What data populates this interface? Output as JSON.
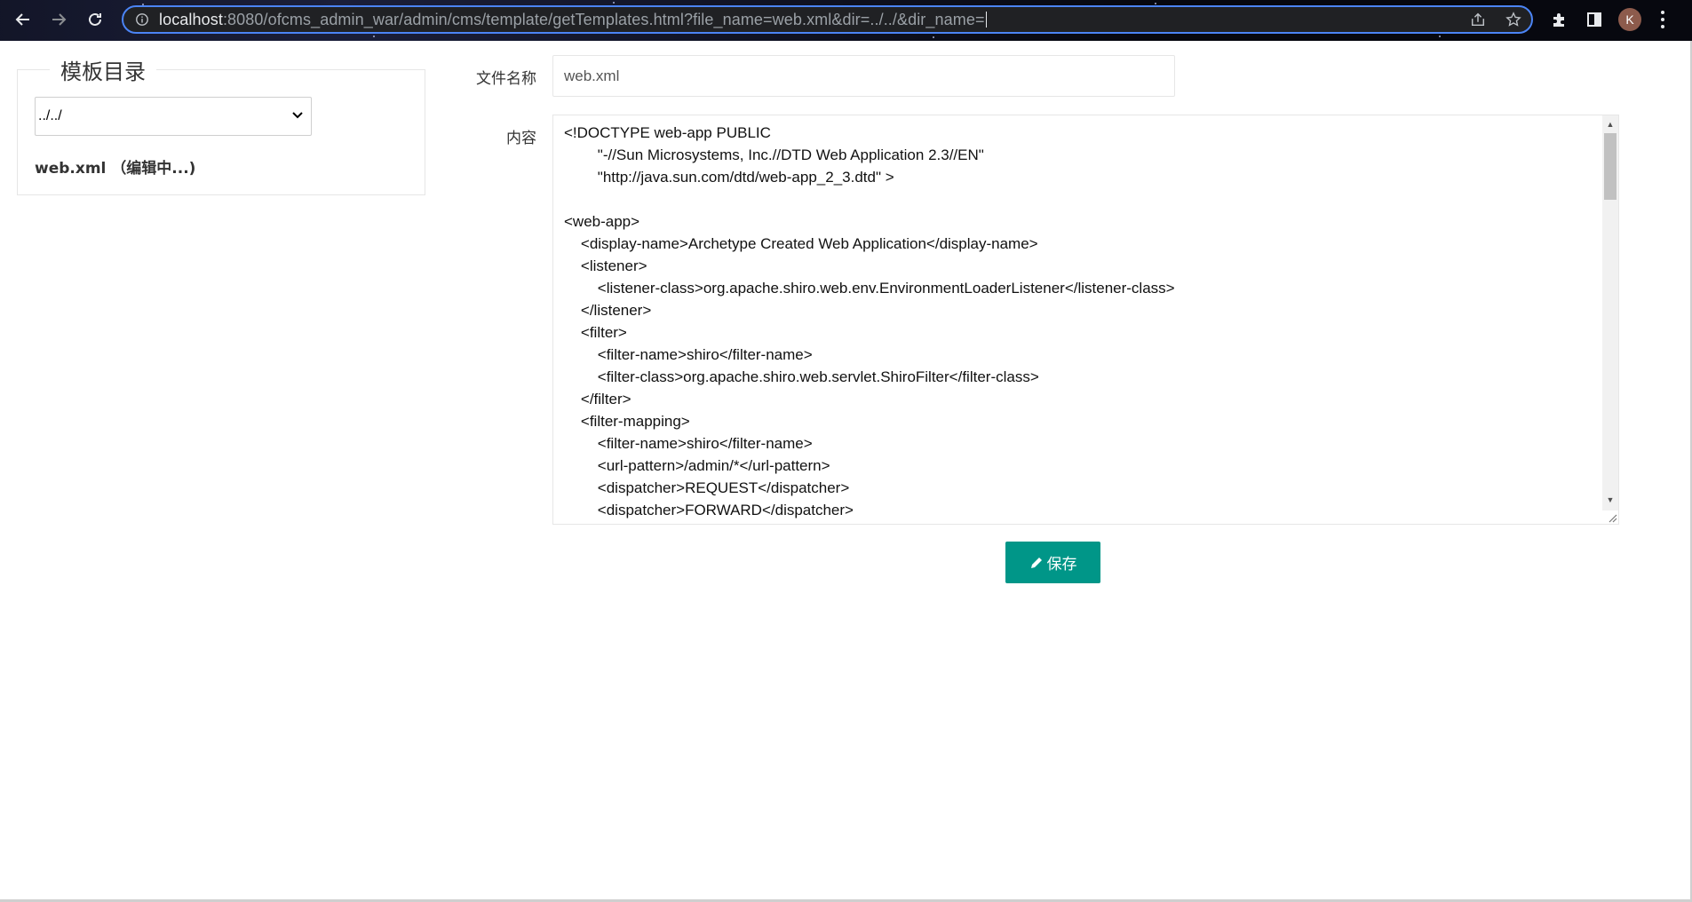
{
  "browser": {
    "url_host": "localhost",
    "url_rest": ":8080/ofcms_admin_war/admin/cms/template/getTemplates.html?file_name=web.xml&dir=../../&dir_name=",
    "profile_initial": "K",
    "accent_color": "#4b84f5"
  },
  "sidebar": {
    "title": "模板目录",
    "dir_selected": "../../",
    "file_label": "web.xml （编辑中...)"
  },
  "form": {
    "name_label": "文件名称",
    "name_value": "web.xml",
    "content_label": "内容",
    "content_lines": [
      "<!DOCTYPE web-app PUBLIC",
      "        \"-//Sun Microsystems, Inc.//DTD Web Application 2.3//EN\"",
      "        \"http://java.sun.com/dtd/web-app_2_3.dtd\" >",
      "",
      "<web-app>",
      "    <display-name>Archetype Created Web Application</display-name>",
      "    <listener>",
      "        <listener-class>org.apache.shiro.web.env.EnvironmentLoaderListener</listener-class>",
      "    </listener>",
      "    <filter>",
      "        <filter-name>shiro</filter-name>",
      "        <filter-class>org.apache.shiro.web.servlet.ShiroFilter</filter-class>",
      "    </filter>",
      "    <filter-mapping>",
      "        <filter-name>shiro</filter-name>",
      "        <url-pattern>/admin/*</url-pattern>",
      "        <dispatcher>REQUEST</dispatcher>",
      "        <dispatcher>FORWARD</dispatcher>"
    ],
    "save_label": "保存",
    "save_color": "#009688"
  }
}
